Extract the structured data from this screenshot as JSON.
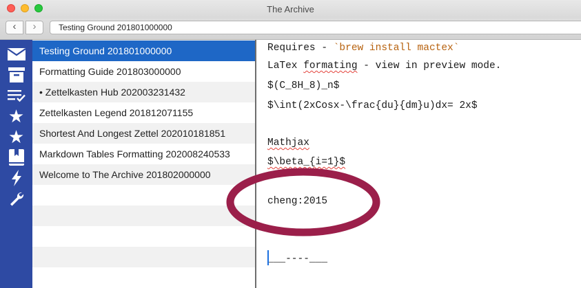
{
  "window": {
    "title": "The Archive"
  },
  "toolbar": {
    "back_label": "‹",
    "forward_label": "›",
    "search_value": "Testing Ground 201801000000"
  },
  "sidebar": {
    "icons": [
      "inbox-icon",
      "archive-icon",
      "checklist-icon",
      "star-icon",
      "star-icon",
      "bookmark-icon",
      "lightning-icon",
      "wrench-icon"
    ]
  },
  "notes": [
    {
      "title": "Testing Ground 201801000000",
      "selected": true
    },
    {
      "title": "Formatting Guide 201803000000",
      "selected": false
    },
    {
      "title": "• Zettelkasten Hub 202003231432",
      "selected": false
    },
    {
      "title": "Zettelkasten Legend 201812071155",
      "selected": false
    },
    {
      "title": "Shortest And Longest Zettel 202010181851",
      "selected": false
    },
    {
      "title": "Markdown Tables Formatting 202008240533",
      "selected": false
    },
    {
      "title": "Welcome to The Archive 201802000000",
      "selected": false
    }
  ],
  "editor": {
    "line1_prefix": "Requires - ",
    "line1_code": "`brew install mactex`",
    "line2_a": "LaTex ",
    "line2_b": "formating",
    "line2_c": " - view in preview mode.",
    "line3": "$(C_8H_8)_n$",
    "line4": "$\\int(2xCosx-\\frac{du}{dm}u)dx= 2x$",
    "line5": "Mathjax",
    "line6": "$\\beta_{i=1}$",
    "line7": "cheng:2015",
    "line8": "___----___"
  },
  "colors": {
    "sidebar_bg": "#2e4aa3",
    "selection_bg": "#1e67c6",
    "annotation": "#9b1f4a",
    "code_color": "#b7620f"
  }
}
